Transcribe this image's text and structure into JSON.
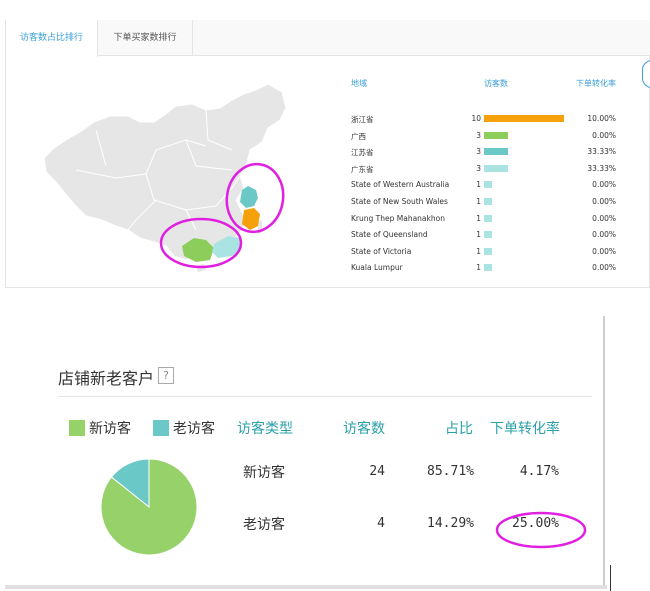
{
  "tabs": [
    {
      "label": "访客数占比排行",
      "active": true
    },
    {
      "label": "下单买家数排行",
      "active": false
    }
  ],
  "ranking": {
    "headers": {
      "region": "地域",
      "visitors": "访客数",
      "conversion": "下单转化率"
    },
    "rows": [
      {
        "region": "浙江省",
        "visitors": "10",
        "rate": "10.00%",
        "fraction": 1.0,
        "color": "#f5a10c"
      },
      {
        "region": "广西",
        "visitors": "3",
        "rate": "0.00%",
        "fraction": 0.3,
        "color": "#8ccd5c"
      },
      {
        "region": "江苏省",
        "visitors": "3",
        "rate": "33.33%",
        "fraction": 0.3,
        "color": "#6ac9c7"
      },
      {
        "region": "广东省",
        "visitors": "3",
        "rate": "33.33%",
        "fraction": 0.3,
        "color": "#a9e3e2"
      },
      {
        "region": "State of Western Australia",
        "visitors": "1",
        "rate": "0.00%",
        "fraction": 0.1,
        "color": "#a9e3e2"
      },
      {
        "region": "State of New South Wales",
        "visitors": "1",
        "rate": "0.00%",
        "fraction": 0.1,
        "color": "#a9e3e2"
      },
      {
        "region": "Krung Thep Mahanakhon",
        "visitors": "1",
        "rate": "0.00%",
        "fraction": 0.1,
        "color": "#a9e3e2"
      },
      {
        "region": "State of Queensland",
        "visitors": "1",
        "rate": "0.00%",
        "fraction": 0.1,
        "color": "#a9e3e2"
      },
      {
        "region": "State of Victoria",
        "visitors": "1",
        "rate": "0.00%",
        "fraction": 0.1,
        "color": "#a9e3e2"
      },
      {
        "region": "Kuala Lumpur",
        "visitors": "1",
        "rate": "0.00%",
        "fraction": 0.1,
        "color": "#a9e3e2"
      }
    ]
  },
  "customers": {
    "title": "店铺新老客户",
    "help": "?",
    "legend": [
      {
        "label": "新访客",
        "color": "#96d16a"
      },
      {
        "label": "老访客",
        "color": "#6ac9c7"
      }
    ],
    "columns": {
      "type": "访客类型",
      "visitors": "访客数",
      "share": "占比",
      "conversion": "下单转化率"
    },
    "rows": [
      {
        "type": "新访客",
        "visitors": "24",
        "share": "85.71%",
        "conversion": "4.17%"
      },
      {
        "type": "老访客",
        "visitors": "4",
        "share": "14.29%",
        "conversion": "25.00%"
      }
    ]
  },
  "colors": {
    "accent": "#3a9fd6",
    "teal_header": "#2aa0a8",
    "highlight_circle": "#e020e0",
    "map_base": "#e6e6e6"
  }
}
